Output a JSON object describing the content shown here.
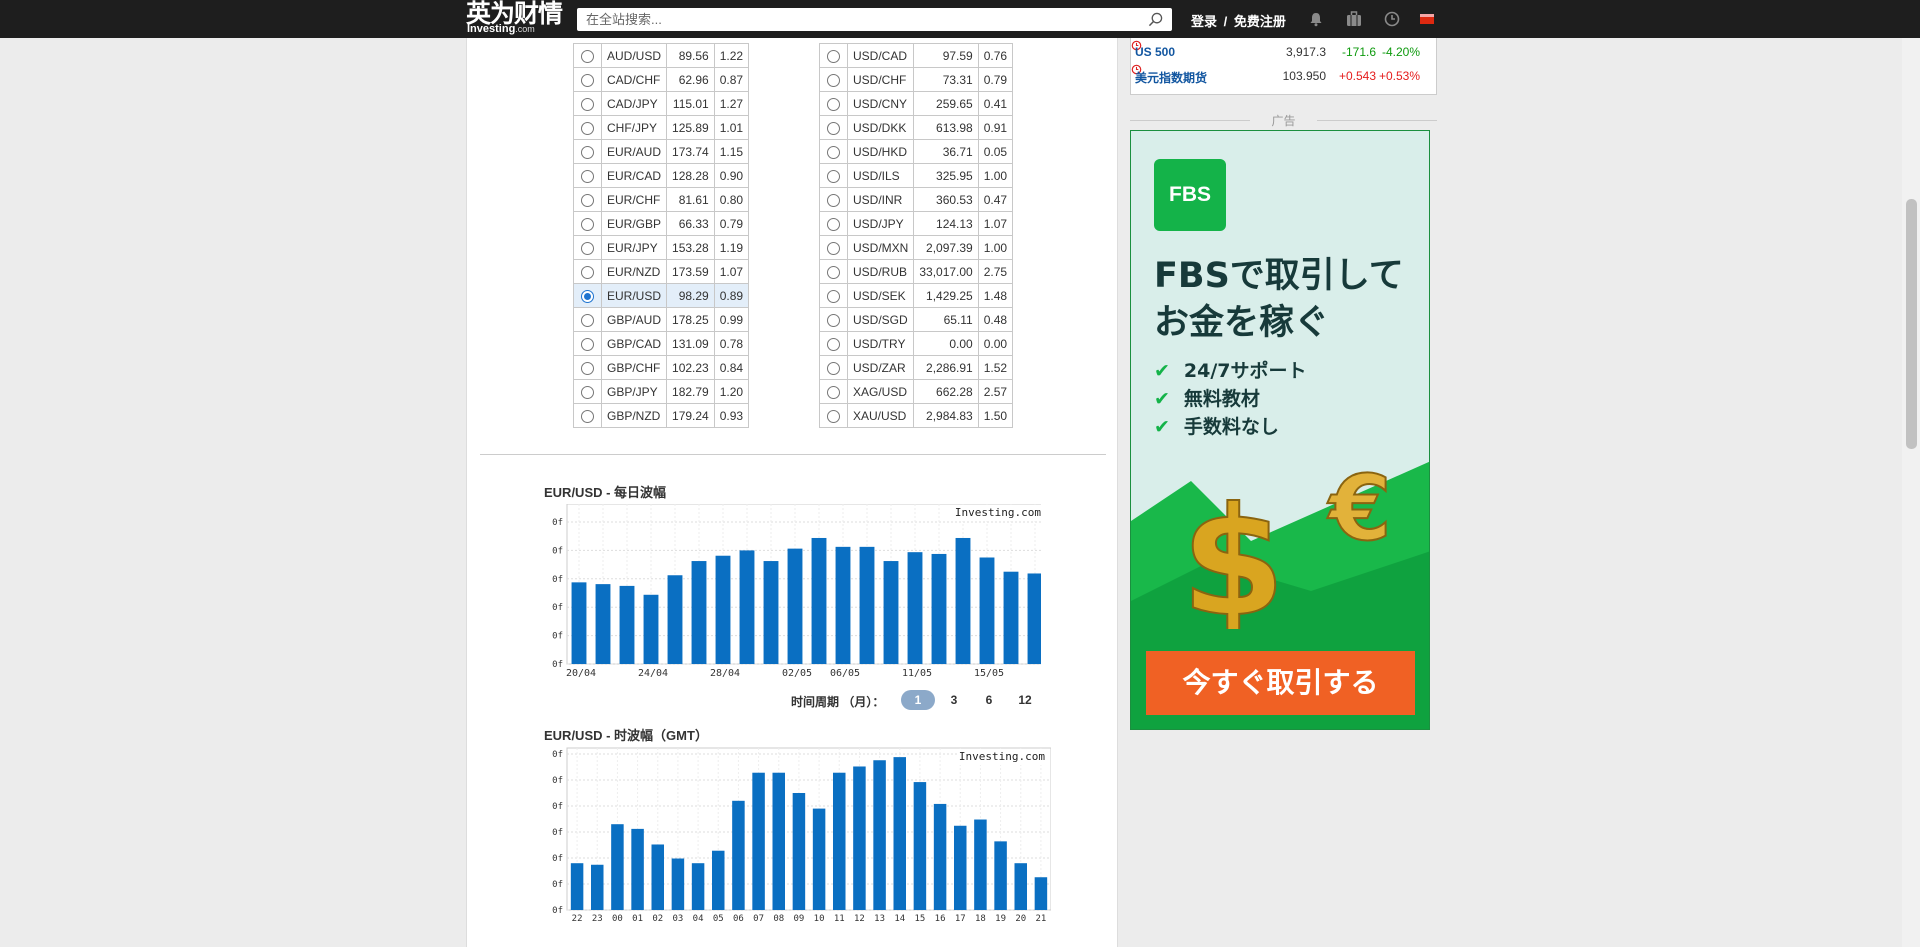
{
  "header": {
    "logo_cn": "英为财情",
    "logo_en": "Investing",
    "logo_en_suffix": ".com",
    "search_placeholder": "在全站搜索...",
    "login": "登录",
    "separator": "/",
    "register": "免费注册",
    "icons": [
      "bell-icon",
      "briefcase-icon",
      "clock-icon",
      "flag-icon"
    ]
  },
  "pairs_left": [
    {
      "pair": "AUD/USD",
      "v1": "89.56",
      "v2": "1.22",
      "selected": false
    },
    {
      "pair": "CAD/CHF",
      "v1": "62.96",
      "v2": "0.87",
      "selected": false
    },
    {
      "pair": "CAD/JPY",
      "v1": "115.01",
      "v2": "1.27",
      "selected": false
    },
    {
      "pair": "CHF/JPY",
      "v1": "125.89",
      "v2": "1.01",
      "selected": false
    },
    {
      "pair": "EUR/AUD",
      "v1": "173.74",
      "v2": "1.15",
      "selected": false
    },
    {
      "pair": "EUR/CAD",
      "v1": "128.28",
      "v2": "0.90",
      "selected": false
    },
    {
      "pair": "EUR/CHF",
      "v1": "81.61",
      "v2": "0.80",
      "selected": false
    },
    {
      "pair": "EUR/GBP",
      "v1": "66.33",
      "v2": "0.79",
      "selected": false
    },
    {
      "pair": "EUR/JPY",
      "v1": "153.28",
      "v2": "1.19",
      "selected": false
    },
    {
      "pair": "EUR/NZD",
      "v1": "173.59",
      "v2": "1.07",
      "selected": false
    },
    {
      "pair": "EUR/USD",
      "v1": "98.29",
      "v2": "0.89",
      "selected": true
    },
    {
      "pair": "GBP/AUD",
      "v1": "178.25",
      "v2": "0.99",
      "selected": false
    },
    {
      "pair": "GBP/CAD",
      "v1": "131.09",
      "v2": "0.78",
      "selected": false
    },
    {
      "pair": "GBP/CHF",
      "v1": "102.23",
      "v2": "0.84",
      "selected": false
    },
    {
      "pair": "GBP/JPY",
      "v1": "182.79",
      "v2": "1.20",
      "selected": false
    },
    {
      "pair": "GBP/NZD",
      "v1": "179.24",
      "v2": "0.93",
      "selected": false
    }
  ],
  "pairs_right": [
    {
      "pair": "USD/CAD",
      "v1": "97.59",
      "v2": "0.76",
      "selected": false
    },
    {
      "pair": "USD/CHF",
      "v1": "73.31",
      "v2": "0.79",
      "selected": false
    },
    {
      "pair": "USD/CNY",
      "v1": "259.65",
      "v2": "0.41",
      "selected": false
    },
    {
      "pair": "USD/DKK",
      "v1": "613.98",
      "v2": "0.91",
      "selected": false
    },
    {
      "pair": "USD/HKD",
      "v1": "36.71",
      "v2": "0.05",
      "selected": false
    },
    {
      "pair": "USD/ILS",
      "v1": "325.95",
      "v2": "1.00",
      "selected": false
    },
    {
      "pair": "USD/INR",
      "v1": "360.53",
      "v2": "0.47",
      "selected": false
    },
    {
      "pair": "USD/JPY",
      "v1": "124.13",
      "v2": "1.07",
      "selected": false
    },
    {
      "pair": "USD/MXN",
      "v1": "2,097.39",
      "v2": "1.00",
      "selected": false
    },
    {
      "pair": "USD/RUB",
      "v1": "33,017.00",
      "v2": "2.75",
      "selected": false
    },
    {
      "pair": "USD/SEK",
      "v1": "1,429.25",
      "v2": "1.48",
      "selected": false
    },
    {
      "pair": "USD/SGD",
      "v1": "65.11",
      "v2": "0.48",
      "selected": false
    },
    {
      "pair": "USD/TRY",
      "v1": "0.00",
      "v2": "0.00",
      "selected": false
    },
    {
      "pair": "USD/ZAR",
      "v1": "2,286.91",
      "v2": "1.52",
      "selected": false
    },
    {
      "pair": "XAG/USD",
      "v1": "662.28",
      "v2": "2.57",
      "selected": false
    },
    {
      "pair": "XAU/USD",
      "v1": "2,984.83",
      "v2": "1.50",
      "selected": false
    }
  ],
  "period": {
    "label": "时间周期 （月）：",
    "options": [
      "1",
      "3",
      "6",
      "12"
    ],
    "active": "1"
  },
  "chart_data": [
    {
      "type": "bar",
      "title": "EUR/USD - 每日波幅",
      "watermark": "Investing.com",
      "color": "#0a6fc2",
      "y_tick_labels": [
        "0f",
        "0f",
        "0f",
        "0f",
        "0f",
        "0f"
      ],
      "x_tick_labels": [
        "20/04",
        "24/04",
        "28/04",
        "02/05",
        "06/05",
        "11/05",
        "15/05"
      ],
      "values": [
        46,
        45,
        44,
        39,
        50,
        58,
        61,
        64,
        58,
        65,
        71,
        66,
        66,
        58,
        63,
        62,
        71,
        60,
        52,
        51
      ]
    },
    {
      "type": "bar",
      "title": "EUR/USD - 时波幅（GMT）",
      "watermark": "Investing.com",
      "color": "#0a6fc2",
      "y_tick_labels": [
        "0f",
        "0f",
        "0f",
        "0f",
        "0f",
        "0f",
        "0f"
      ],
      "categories": [
        "22",
        "23",
        "00",
        "01",
        "02",
        "03",
        "04",
        "05",
        "06",
        "07",
        "08",
        "09",
        "10",
        "11",
        "12",
        "13",
        "14",
        "15",
        "16",
        "17",
        "18",
        "19",
        "20",
        "21"
      ],
      "values": [
        30,
        29,
        55,
        52,
        42,
        33,
        30,
        38,
        70,
        88,
        88,
        75,
        65,
        88,
        92,
        96,
        98,
        82,
        68,
        54,
        58,
        44,
        30,
        21
      ]
    }
  ],
  "sidebar": {
    "indices": [
      {
        "name": "US 500",
        "price": "3,917.3",
        "change": "-171.6",
        "pct": "-4.20%",
        "change_color": "#0e9a0e"
      },
      {
        "name": "美元指数期货",
        "price": "103.950",
        "change": "+0.543",
        "pct": "+0.53%",
        "change_color": "#e51c1c"
      }
    ],
    "ad_label": "广告",
    "ad": {
      "logo": "FBS",
      "headline_1": "FBSで取引して",
      "headline_2": "お金を稼ぐ",
      "features": [
        "24/7サポート",
        "無料教材",
        "手数料なし"
      ],
      "cta": "今すぐ取引する"
    }
  }
}
